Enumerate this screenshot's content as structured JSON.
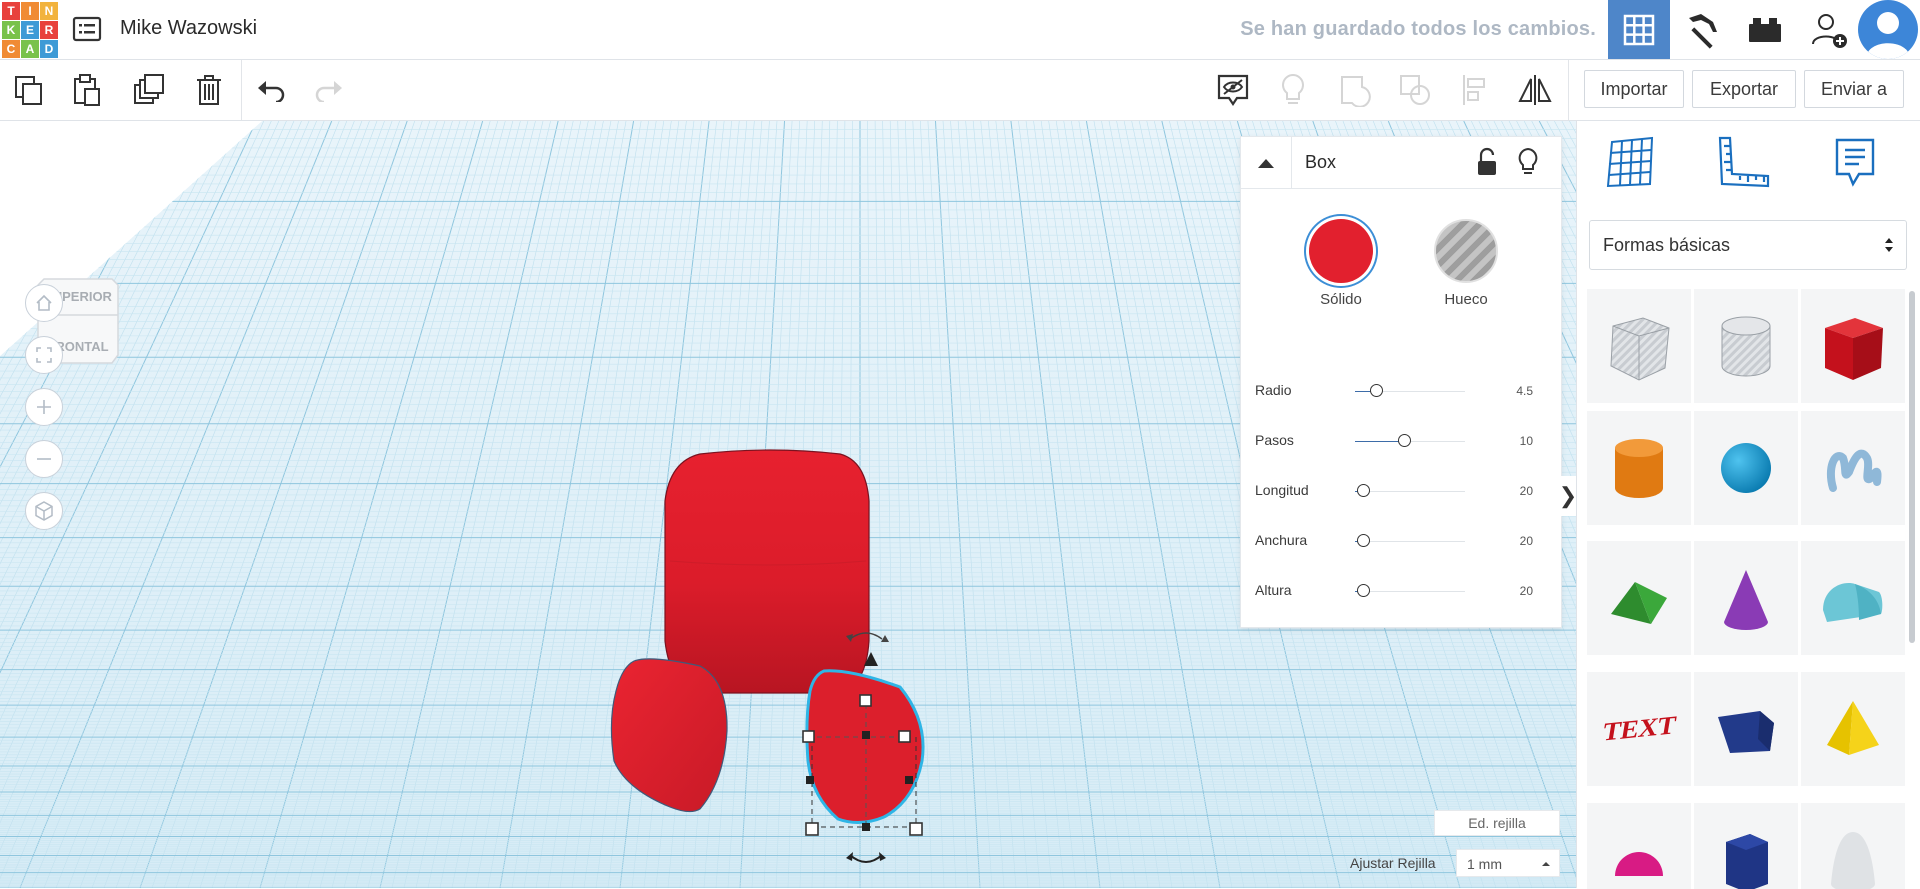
{
  "app": {
    "logo_letters": [
      "T",
      "I",
      "N",
      "K",
      "E",
      "R",
      "C",
      "A",
      "D"
    ],
    "logo_colors": [
      "#e8413c",
      "#f08b34",
      "#f2b33d",
      "#79c24b",
      "#3e9ad6",
      "#e8413c",
      "#f08b34",
      "#79c24b",
      "#3e9ad6"
    ],
    "user_name": "Mike Wazowski",
    "save_status": "Se han guardado todos los cambios."
  },
  "toolbar": {
    "import_label": "Importar",
    "export_label": "Exportar",
    "send_label": "Enviar a"
  },
  "viewcube": {
    "top_label": "SUPERIOR",
    "front_label": "FRONTAL"
  },
  "inspector": {
    "title": "Box",
    "solid_label": "Sólido",
    "hole_label": "Hueco",
    "solid_color": "#e2202e",
    "props": [
      {
        "label": "Radio",
        "value": "4.5",
        "fraction": 0.2
      },
      {
        "label": "Pasos",
        "value": "10",
        "fraction": 0.45
      },
      {
        "label": "Longitud",
        "value": "20",
        "fraction": 0.08
      },
      {
        "label": "Anchura",
        "value": "20",
        "fraction": 0.08
      },
      {
        "label": "Altura",
        "value": "20",
        "fraction": 0.08
      }
    ]
  },
  "panel": {
    "category": "Formas básicas",
    "shapes": [
      "box-hole-icon",
      "cylinder-hole-icon",
      "box-icon",
      "cylinder-icon",
      "sphere-icon",
      "scribble-icon",
      "roof-icon",
      "cone-icon",
      "round-roof-icon",
      "text-icon",
      "wedge-icon",
      "pyramid-icon",
      "half-sphere-icon",
      "polygon-icon",
      "paraboloid-icon"
    ],
    "text_shape_label": "TEXT"
  },
  "grid": {
    "edit_label": "Ed. rejilla",
    "snap_label": "Ajustar Rejilla",
    "snap_value": "1 mm"
  }
}
